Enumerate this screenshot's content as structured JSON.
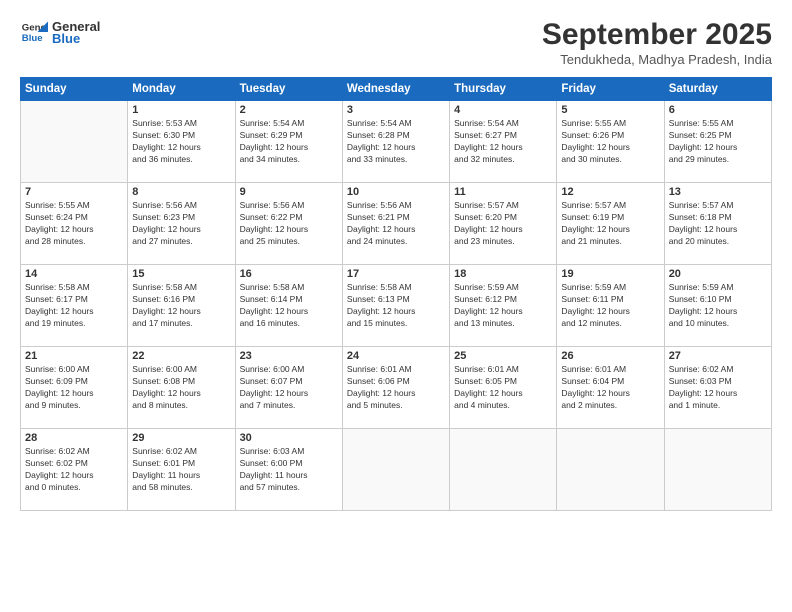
{
  "logo": {
    "line1": "General",
    "line2": "Blue"
  },
  "title": "September 2025",
  "location": "Tendukheda, Madhya Pradesh, India",
  "headers": [
    "Sunday",
    "Monday",
    "Tuesday",
    "Wednesday",
    "Thursday",
    "Friday",
    "Saturday"
  ],
  "weeks": [
    [
      {
        "day": "",
        "info": ""
      },
      {
        "day": "1",
        "info": "Sunrise: 5:53 AM\nSunset: 6:30 PM\nDaylight: 12 hours\nand 36 minutes."
      },
      {
        "day": "2",
        "info": "Sunrise: 5:54 AM\nSunset: 6:29 PM\nDaylight: 12 hours\nand 34 minutes."
      },
      {
        "day": "3",
        "info": "Sunrise: 5:54 AM\nSunset: 6:28 PM\nDaylight: 12 hours\nand 33 minutes."
      },
      {
        "day": "4",
        "info": "Sunrise: 5:54 AM\nSunset: 6:27 PM\nDaylight: 12 hours\nand 32 minutes."
      },
      {
        "day": "5",
        "info": "Sunrise: 5:55 AM\nSunset: 6:26 PM\nDaylight: 12 hours\nand 30 minutes."
      },
      {
        "day": "6",
        "info": "Sunrise: 5:55 AM\nSunset: 6:25 PM\nDaylight: 12 hours\nand 29 minutes."
      }
    ],
    [
      {
        "day": "7",
        "info": "Sunrise: 5:55 AM\nSunset: 6:24 PM\nDaylight: 12 hours\nand 28 minutes."
      },
      {
        "day": "8",
        "info": "Sunrise: 5:56 AM\nSunset: 6:23 PM\nDaylight: 12 hours\nand 27 minutes."
      },
      {
        "day": "9",
        "info": "Sunrise: 5:56 AM\nSunset: 6:22 PM\nDaylight: 12 hours\nand 25 minutes."
      },
      {
        "day": "10",
        "info": "Sunrise: 5:56 AM\nSunset: 6:21 PM\nDaylight: 12 hours\nand 24 minutes."
      },
      {
        "day": "11",
        "info": "Sunrise: 5:57 AM\nSunset: 6:20 PM\nDaylight: 12 hours\nand 23 minutes."
      },
      {
        "day": "12",
        "info": "Sunrise: 5:57 AM\nSunset: 6:19 PM\nDaylight: 12 hours\nand 21 minutes."
      },
      {
        "day": "13",
        "info": "Sunrise: 5:57 AM\nSunset: 6:18 PM\nDaylight: 12 hours\nand 20 minutes."
      }
    ],
    [
      {
        "day": "14",
        "info": "Sunrise: 5:58 AM\nSunset: 6:17 PM\nDaylight: 12 hours\nand 19 minutes."
      },
      {
        "day": "15",
        "info": "Sunrise: 5:58 AM\nSunset: 6:16 PM\nDaylight: 12 hours\nand 17 minutes."
      },
      {
        "day": "16",
        "info": "Sunrise: 5:58 AM\nSunset: 6:14 PM\nDaylight: 12 hours\nand 16 minutes."
      },
      {
        "day": "17",
        "info": "Sunrise: 5:58 AM\nSunset: 6:13 PM\nDaylight: 12 hours\nand 15 minutes."
      },
      {
        "day": "18",
        "info": "Sunrise: 5:59 AM\nSunset: 6:12 PM\nDaylight: 12 hours\nand 13 minutes."
      },
      {
        "day": "19",
        "info": "Sunrise: 5:59 AM\nSunset: 6:11 PM\nDaylight: 12 hours\nand 12 minutes."
      },
      {
        "day": "20",
        "info": "Sunrise: 5:59 AM\nSunset: 6:10 PM\nDaylight: 12 hours\nand 10 minutes."
      }
    ],
    [
      {
        "day": "21",
        "info": "Sunrise: 6:00 AM\nSunset: 6:09 PM\nDaylight: 12 hours\nand 9 minutes."
      },
      {
        "day": "22",
        "info": "Sunrise: 6:00 AM\nSunset: 6:08 PM\nDaylight: 12 hours\nand 8 minutes."
      },
      {
        "day": "23",
        "info": "Sunrise: 6:00 AM\nSunset: 6:07 PM\nDaylight: 12 hours\nand 7 minutes."
      },
      {
        "day": "24",
        "info": "Sunrise: 6:01 AM\nSunset: 6:06 PM\nDaylight: 12 hours\nand 5 minutes."
      },
      {
        "day": "25",
        "info": "Sunrise: 6:01 AM\nSunset: 6:05 PM\nDaylight: 12 hours\nand 4 minutes."
      },
      {
        "day": "26",
        "info": "Sunrise: 6:01 AM\nSunset: 6:04 PM\nDaylight: 12 hours\nand 2 minutes."
      },
      {
        "day": "27",
        "info": "Sunrise: 6:02 AM\nSunset: 6:03 PM\nDaylight: 12 hours\nand 1 minute."
      }
    ],
    [
      {
        "day": "28",
        "info": "Sunrise: 6:02 AM\nSunset: 6:02 PM\nDaylight: 12 hours\nand 0 minutes."
      },
      {
        "day": "29",
        "info": "Sunrise: 6:02 AM\nSunset: 6:01 PM\nDaylight: 11 hours\nand 58 minutes."
      },
      {
        "day": "30",
        "info": "Sunrise: 6:03 AM\nSunset: 6:00 PM\nDaylight: 11 hours\nand 57 minutes."
      },
      {
        "day": "",
        "info": ""
      },
      {
        "day": "",
        "info": ""
      },
      {
        "day": "",
        "info": ""
      },
      {
        "day": "",
        "info": ""
      }
    ]
  ]
}
